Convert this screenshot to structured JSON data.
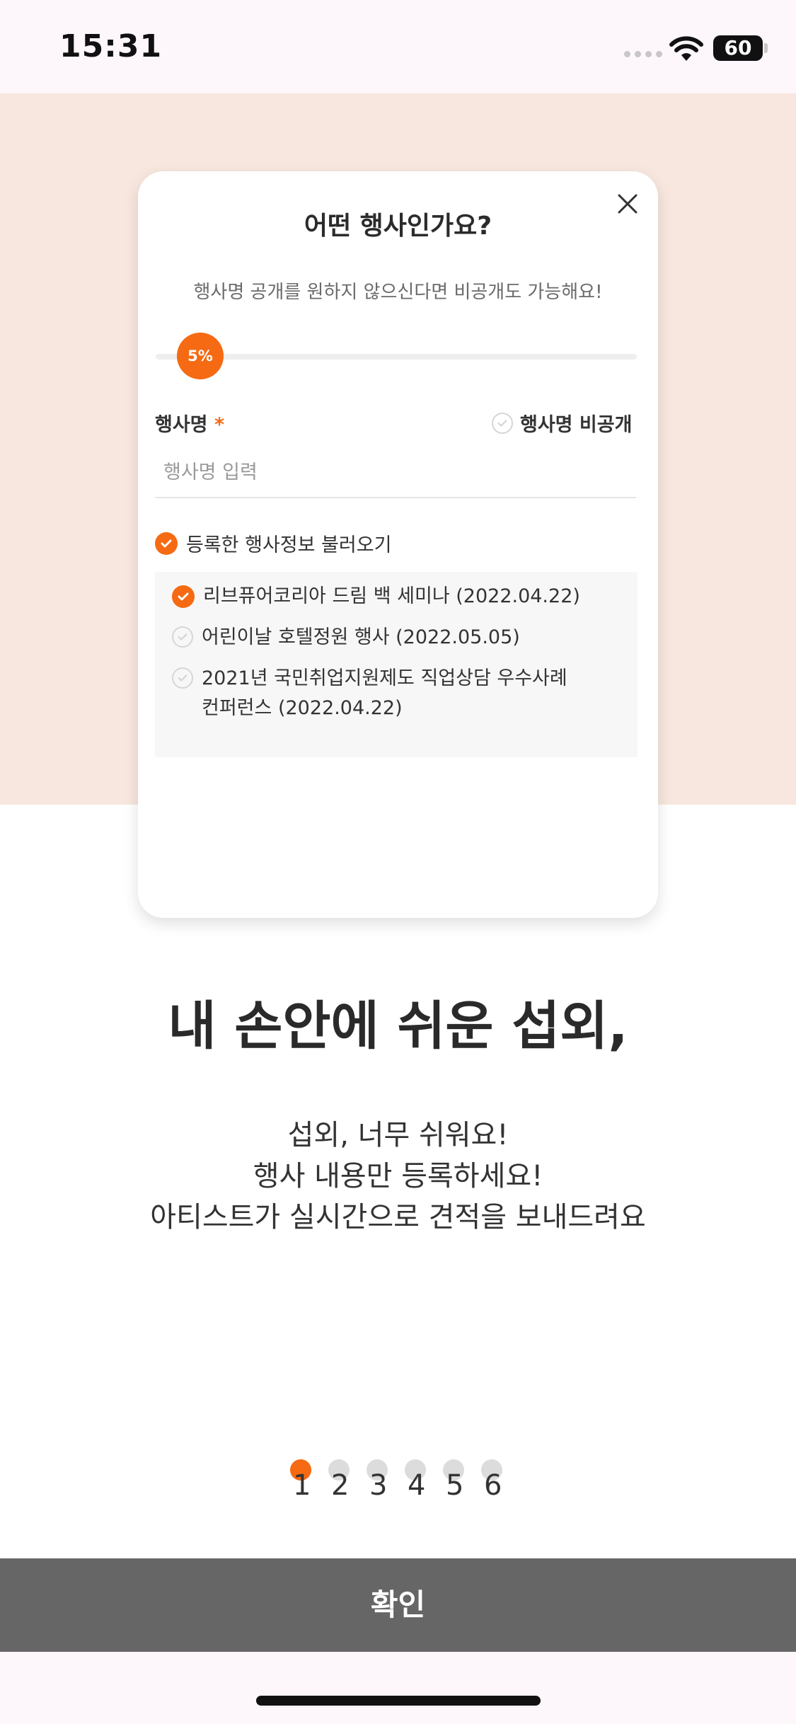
{
  "status_bar": {
    "time": "15:31",
    "battery": "60"
  },
  "card": {
    "title": "어떤 행사인가요?",
    "subtitle": "행사명 공개를 원하지 않으신다면 비공개도 가능해요!",
    "progress": {
      "label": "5%",
      "percent": 5
    },
    "field_label": "행사명",
    "required_mark": "*",
    "private_label": "행사명 비공개",
    "input": {
      "placeholder": "행사명 입력",
      "value": ""
    },
    "load_label": "등록한 행사정보 불러오기",
    "history": [
      {
        "line1": "리브퓨어코리아 드림 백 세미나 (2022.04.22)",
        "line2": "",
        "checked": true
      },
      {
        "line1": "어린이날 호텔정원 행사 (2022.05.05)",
        "line2": "",
        "checked": false
      },
      {
        "line1": "2021년 국민취업지원제도 직업상담 우수사례",
        "line2": "컨퍼런스 (2022.04.22)",
        "checked": false
      }
    ]
  },
  "main": {
    "headline": "내 손안에 쉬운 섭외,",
    "desc_lines": [
      "섭외, 너무 쉬워요!",
      "행사 내용만 등록하세요!",
      "아티스트가 실시간으로 견적을 보내드려요"
    ]
  },
  "pager": {
    "pages": [
      "1",
      "2",
      "3",
      "4",
      "5",
      "6"
    ],
    "active": 0
  },
  "confirm_label": "확인",
  "colors": {
    "accent": "#f56a12",
    "hero_bg": "#f8e7de",
    "button_bg": "#666666"
  }
}
